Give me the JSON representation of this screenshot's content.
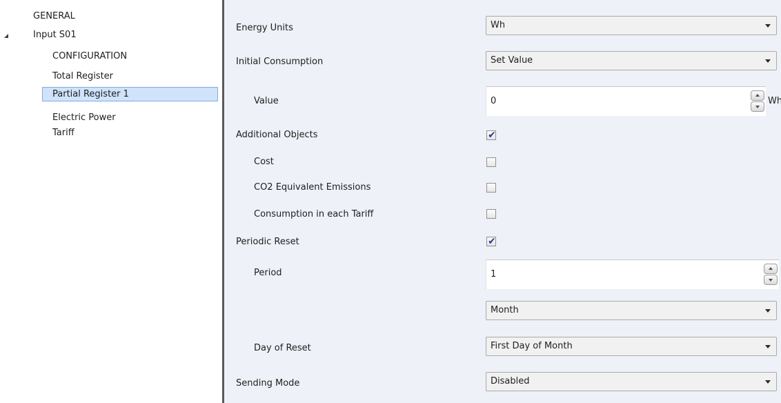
{
  "tree": {
    "general": "GENERAL",
    "input": "Input S01",
    "configuration": "CONFIGURATION",
    "total_register": "Total Register",
    "partial_register": "Partial Register 1",
    "electric_power": "Electric Power",
    "tariff": "Tariff"
  },
  "props": {
    "energy_units": {
      "label": "Energy Units",
      "value": "Wh"
    },
    "initial_consumption": {
      "label": "Initial Consumption",
      "value": "Set Value"
    },
    "value": {
      "label": "Value",
      "value": "0",
      "unit": "Wh"
    },
    "additional_objects": {
      "label": "Additional Objects",
      "checked": true
    },
    "cost": {
      "label": "Cost",
      "checked": false
    },
    "co2": {
      "label": "CO2 Equivalent Emissions",
      "checked": false
    },
    "consumption_tariff": {
      "label": "Consumption in each Tariff",
      "checked": false
    },
    "periodic_reset": {
      "label": "Periodic Reset",
      "checked": true
    },
    "period": {
      "label": "Period",
      "value": "1",
      "unit_value": "Month"
    },
    "day_of_reset": {
      "label": "Day of Reset",
      "value": "First Day of Month"
    },
    "sending_mode": {
      "label": "Sending Mode",
      "value": "Disabled"
    }
  },
  "icons": {
    "checked": "✔"
  }
}
